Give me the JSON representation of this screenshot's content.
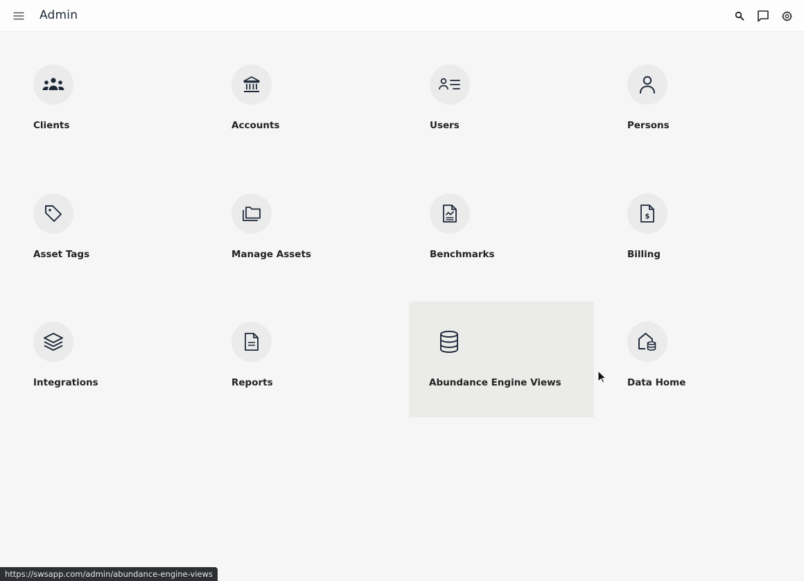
{
  "header": {
    "title": "Admin",
    "menu_icon": "hamburger-menu-icon",
    "search_icon": "search-icon",
    "chat_icon": "chat-icon",
    "settings_icon": "gear-icon"
  },
  "tiles": [
    {
      "label": "Clients",
      "icon": "people-group-icon"
    },
    {
      "label": "Accounts",
      "icon": "bank-icon"
    },
    {
      "label": "Users",
      "icon": "user-list-icon"
    },
    {
      "label": "Persons",
      "icon": "person-icon"
    },
    {
      "label": "Asset Tags",
      "icon": "tag-icon"
    },
    {
      "label": "Manage Assets",
      "icon": "folders-icon"
    },
    {
      "label": "Benchmarks",
      "icon": "document-chart-icon"
    },
    {
      "label": "Billing",
      "icon": "document-dollar-icon"
    },
    {
      "label": "Integrations",
      "icon": "layers-icon"
    },
    {
      "label": "Reports",
      "icon": "document-icon"
    },
    {
      "label": "Abundance Engine Views",
      "icon": "database-icon"
    },
    {
      "label": "Data Home",
      "icon": "home-database-icon"
    }
  ],
  "status_bar": {
    "url": "https://swsapp.com/admin/abundance-engine-views"
  },
  "colors": {
    "background": "#f6f6f7",
    "icon_circle": "#ebebeb",
    "hover_tile": "#ebebe9",
    "text": "#222222"
  }
}
